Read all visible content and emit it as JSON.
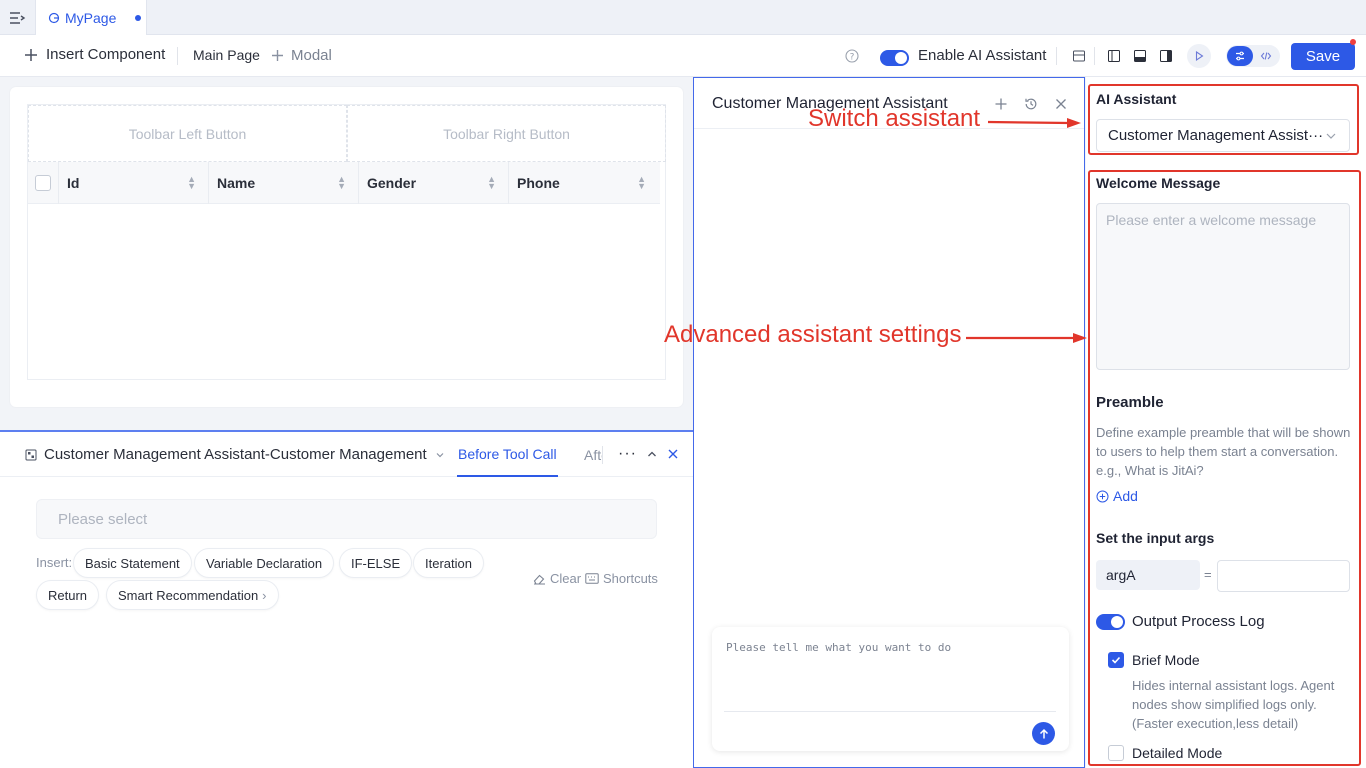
{
  "colors": {
    "accent": "#2d59e6",
    "annotation": "#e1362b"
  },
  "tab": {
    "label": "MyPage"
  },
  "toolbar": {
    "insert_component": "Insert Component",
    "main_page": "Main Page",
    "modal": "Modal",
    "enable_ai": "Enable AI Assistant",
    "save": "Save"
  },
  "canvas": {
    "toolbar_left": "Toolbar Left Button",
    "toolbar_right": "Toolbar Right Button",
    "columns": [
      "Id",
      "Name",
      "Gender",
      "Phone"
    ]
  },
  "function_panel": {
    "title": "Customer Management Assistant-Customer Management",
    "tab_before": "Before Tool Call",
    "tab_after": "After Tool Call",
    "select_placeholder": "Please select",
    "insert_label": "Insert:",
    "chips": [
      "Basic Statement",
      "Variable Declaration",
      "IF-ELSE",
      "Iteration",
      "Return",
      "Smart Recommendation"
    ],
    "clear": "Clear",
    "shortcuts": "Shortcuts"
  },
  "chat": {
    "title": "Customer Management Assistant",
    "input_placeholder": "Please tell me what you want to do"
  },
  "settings": {
    "ai_assistant_label": "AI Assistant",
    "selected_assistant": "Customer Management Assist···",
    "welcome_label": "Welcome Message",
    "welcome_placeholder": "Please enter a welcome message",
    "preamble_label": "Preamble",
    "preamble_desc": "Define example preamble that will be shown to users to help them start a conversation. e.g., What is JitAi?",
    "add": "Add",
    "input_args_label": "Set the input args",
    "arg_name": "argA",
    "equals": "=",
    "output_log": "Output Process Log",
    "brief_mode": "Brief Mode",
    "brief_desc": "Hides internal assistant logs. Agent nodes show simplified logs only. (Faster execution,less detail)",
    "detailed_mode": "Detailed Mode"
  },
  "annotations": {
    "switch": "Switch assistant",
    "advanced": "Advanced assistant settings"
  }
}
